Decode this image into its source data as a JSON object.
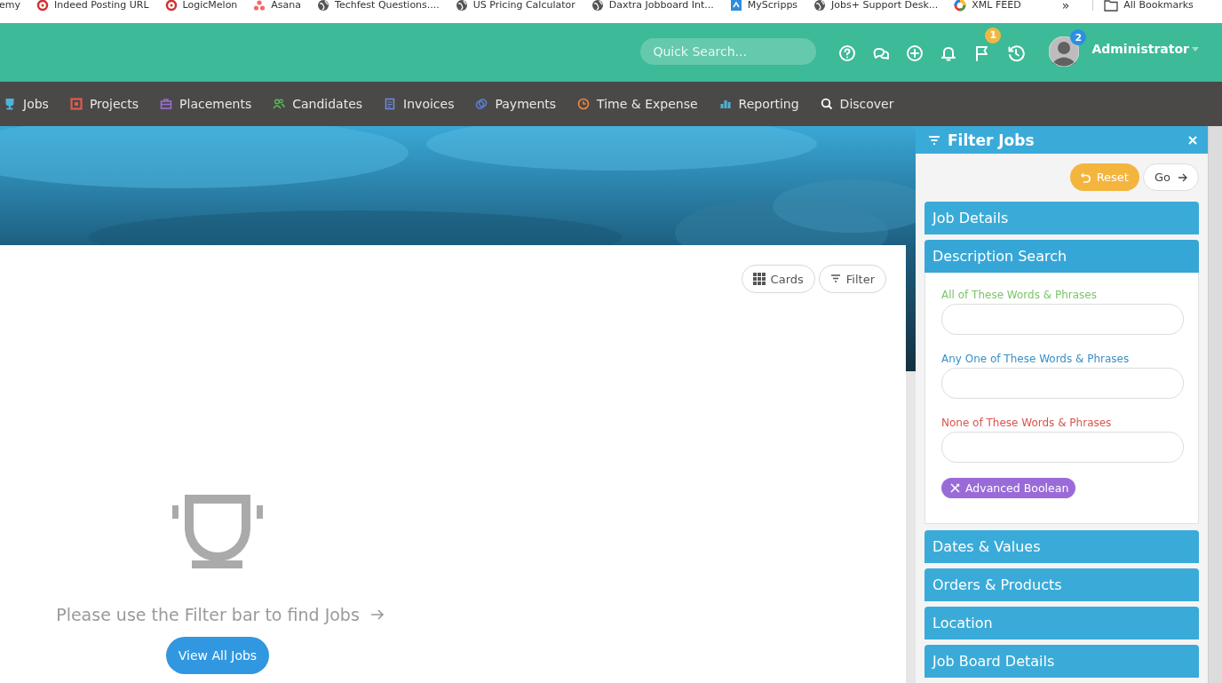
{
  "bookmarks": [
    {
      "label": "emy"
    },
    {
      "label": "Indeed Posting URL"
    },
    {
      "label": "LogicMelon"
    },
    {
      "label": "Asana"
    },
    {
      "label": "Techfest Questions...."
    },
    {
      "label": "US Pricing Calculator"
    },
    {
      "label": "Daxtra Jobboard Int..."
    },
    {
      "label": "MyScripps"
    },
    {
      "label": "Jobs+ Support Desk..."
    },
    {
      "label": "XML FEED"
    }
  ],
  "more_bookmarks": "»",
  "all_bookmarks": "All Bookmarks",
  "header": {
    "search": {
      "placeholder": "Quick Search..."
    },
    "flag_badge": "1",
    "avatar_badge": "2",
    "user_name": "Administrator"
  },
  "nav": [
    {
      "label": "Jobs",
      "color": "#4fb3d9"
    },
    {
      "label": "Projects",
      "color": "#e05a4f"
    },
    {
      "label": "Placements",
      "color": "#9b6fd6"
    },
    {
      "label": "Candidates",
      "color": "#5cb85c"
    },
    {
      "label": "Invoices",
      "color": "#6d8fe0"
    },
    {
      "label": "Payments",
      "color": "#5b7fe0"
    },
    {
      "label": "Time & Expense",
      "color": "#f0883e"
    },
    {
      "label": "Reporting",
      "color": "#4fb3d9"
    },
    {
      "label": "Discover",
      "color": "#ffffff"
    }
  ],
  "content": {
    "view_buttons": [
      "Cards",
      "Filter"
    ],
    "empty_message": "Please use the Filter bar to find Jobs",
    "view_all": "View All Jobs"
  },
  "filter_panel": {
    "title": "Filter Jobs",
    "reset": "Reset",
    "go": "Go",
    "sections": [
      {
        "title": "Job Details"
      },
      {
        "title": "Description Search",
        "fields": [
          {
            "label": "All of These Words & Phrases",
            "color": "#7cc46a"
          },
          {
            "label": "Any One of These Words & Phrases",
            "color": "#3a8fc8"
          },
          {
            "label": "None of These Words & Phrases",
            "color": "#d9534f"
          }
        ],
        "pill": "Advanced Boolean"
      },
      {
        "title": "Dates & Values"
      },
      {
        "title": "Orders & Products"
      },
      {
        "title": "Location"
      },
      {
        "title": "Job Board Details"
      }
    ]
  }
}
